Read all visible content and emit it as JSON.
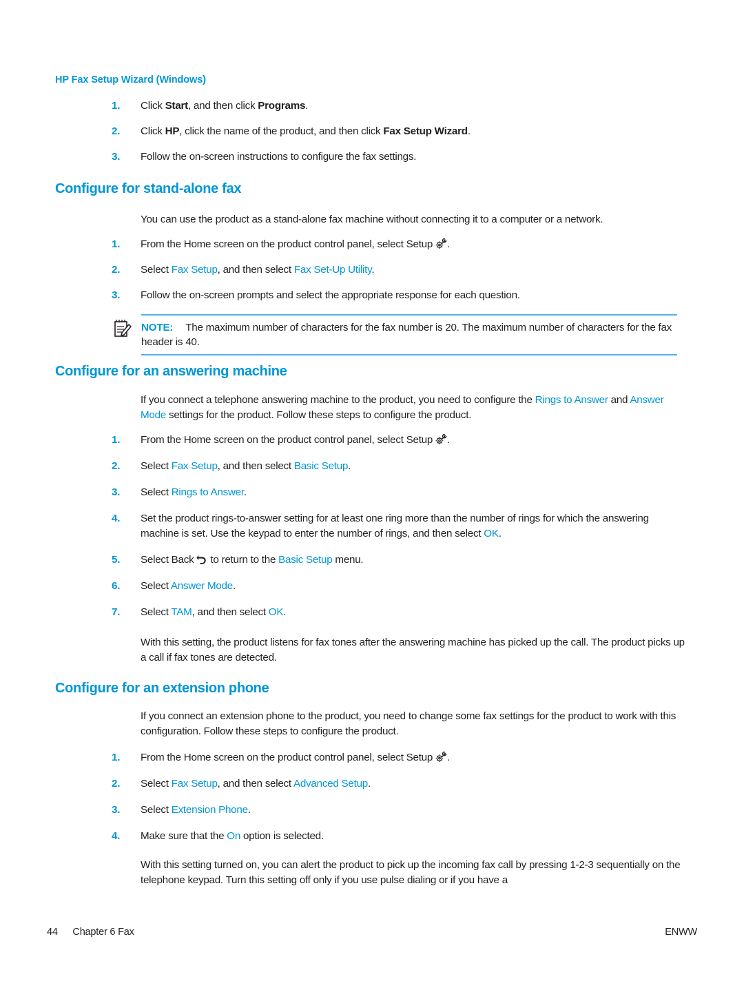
{
  "document": {
    "page_number": "44",
    "chapter": "Chapter 6  Fax",
    "locale_code": "ENWW",
    "accent_color": "#0096d6",
    "text_color": "#231f20"
  },
  "sections": {
    "wizard": {
      "heading": "HP Fax Setup Wizard (Windows)",
      "steps": [
        {
          "number": "1.",
          "parts": [
            {
              "t": "Click ",
              "style": "normal"
            },
            {
              "t": "Start",
              "style": "bold"
            },
            {
              "t": ", and then click ",
              "style": "normal"
            },
            {
              "t": "Programs",
              "style": "bold"
            },
            {
              "t": ".",
              "style": "normal"
            }
          ]
        },
        {
          "number": "2.",
          "parts": [
            {
              "t": "Click ",
              "style": "normal"
            },
            {
              "t": "HP",
              "style": "bold"
            },
            {
              "t": ", click the name of the product, and then click ",
              "style": "normal"
            },
            {
              "t": "Fax Setup Wizard",
              "style": "bold"
            },
            {
              "t": ".",
              "style": "normal"
            }
          ]
        },
        {
          "number": "3.",
          "parts": [
            {
              "t": "Follow the on-screen instructions to configure the fax settings.",
              "style": "normal"
            }
          ]
        }
      ]
    },
    "standalone": {
      "heading": "Configure for stand-alone fax",
      "intro": "You can use the product as a stand-alone fax machine without connecting it to a computer or a network.",
      "steps": [
        {
          "number": "1.",
          "parts": [
            {
              "t": "From the Home screen on the product control panel, select Setup ",
              "style": "normal"
            },
            {
              "t": "",
              "style": "icon",
              "icon": "setup-gear-wrench-icon"
            },
            {
              "t": ".",
              "style": "normal"
            }
          ]
        },
        {
          "number": "2.",
          "parts": [
            {
              "t": "Select ",
              "style": "normal"
            },
            {
              "t": "Fax Setup",
              "style": "link"
            },
            {
              "t": ", and then select ",
              "style": "normal"
            },
            {
              "t": "Fax Set-Up Utility",
              "style": "link"
            },
            {
              "t": ".",
              "style": "normal"
            }
          ]
        },
        {
          "number": "3.",
          "parts": [
            {
              "t": "Follow the on-screen prompts and select the appropriate response for each question.",
              "style": "normal"
            }
          ]
        }
      ],
      "note": {
        "label": "NOTE:",
        "text": "The maximum number of characters for the fax number is 20. The maximum number of characters for the fax header is 40.",
        "icon": "note-pad-pencil-icon"
      }
    },
    "answering_machine": {
      "heading": "Configure for an answering machine",
      "intro_parts": [
        {
          "t": "If you connect a telephone answering machine to the product, you need to configure the ",
          "style": "normal"
        },
        {
          "t": "Rings to Answer",
          "style": "link"
        },
        {
          "t": " and ",
          "style": "normal"
        },
        {
          "t": "Answer Mode",
          "style": "link"
        },
        {
          "t": " settings for the product. Follow these steps to configure the product.",
          "style": "normal"
        }
      ],
      "steps": [
        {
          "number": "1.",
          "parts": [
            {
              "t": "From the Home screen on the product control panel, select Setup ",
              "style": "normal"
            },
            {
              "t": "",
              "style": "icon",
              "icon": "setup-gear-wrench-icon"
            },
            {
              "t": ".",
              "style": "normal"
            }
          ]
        },
        {
          "number": "2.",
          "parts": [
            {
              "t": "Select ",
              "style": "normal"
            },
            {
              "t": "Fax Setup",
              "style": "link"
            },
            {
              "t": ", and then select ",
              "style": "normal"
            },
            {
              "t": "Basic Setup",
              "style": "link"
            },
            {
              "t": ".",
              "style": "normal"
            }
          ]
        },
        {
          "number": "3.",
          "parts": [
            {
              "t": "Select ",
              "style": "normal"
            },
            {
              "t": "Rings to Answer",
              "style": "link"
            },
            {
              "t": ".",
              "style": "normal"
            }
          ]
        },
        {
          "number": "4.",
          "parts": [
            {
              "t": "Set the product rings-to-answer setting for at least one ring more than the number of rings for which the answering machine is set. Use the keypad to enter the number of rings, and then select ",
              "style": "normal"
            },
            {
              "t": "OK",
              "style": "link"
            },
            {
              "t": ".",
              "style": "normal"
            }
          ]
        },
        {
          "number": "5.",
          "parts": [
            {
              "t": "Select Back ",
              "style": "normal"
            },
            {
              "t": "",
              "style": "icon",
              "icon": "back-arrow-icon"
            },
            {
              "t": " to return to the ",
              "style": "normal"
            },
            {
              "t": "Basic Setup",
              "style": "link"
            },
            {
              "t": " menu.",
              "style": "normal"
            }
          ]
        },
        {
          "number": "6.",
          "parts": [
            {
              "t": "Select ",
              "style": "normal"
            },
            {
              "t": "Answer Mode",
              "style": "link"
            },
            {
              "t": ".",
              "style": "normal"
            }
          ]
        },
        {
          "number": "7.",
          "parts": [
            {
              "t": "Select ",
              "style": "normal"
            },
            {
              "t": "TAM",
              "style": "link"
            },
            {
              "t": ", and then select ",
              "style": "normal"
            },
            {
              "t": "OK",
              "style": "link"
            },
            {
              "t": ".",
              "style": "normal"
            }
          ]
        }
      ],
      "outro": "With this setting, the product listens for fax tones after the answering machine has picked up the call. The product picks up a call if fax tones are detected."
    },
    "extension_phone": {
      "heading": "Configure for an extension phone",
      "intro": "If you connect an extension phone to the product, you need to change some fax settings for the product to work with this configuration. Follow these steps to configure the product.",
      "steps": [
        {
          "number": "1.",
          "parts": [
            {
              "t": "From the Home screen on the product control panel, select Setup ",
              "style": "normal"
            },
            {
              "t": "",
              "style": "icon",
              "icon": "setup-gear-wrench-icon"
            },
            {
              "t": ".",
              "style": "normal"
            }
          ]
        },
        {
          "number": "2.",
          "parts": [
            {
              "t": "Select ",
              "style": "normal"
            },
            {
              "t": "Fax Setup",
              "style": "link"
            },
            {
              "t": ", and then select ",
              "style": "normal"
            },
            {
              "t": "Advanced Setup",
              "style": "link"
            },
            {
              "t": ".",
              "style": "normal"
            }
          ]
        },
        {
          "number": "3.",
          "parts": [
            {
              "t": "Select ",
              "style": "normal"
            },
            {
              "t": "Extension Phone",
              "style": "link"
            },
            {
              "t": ".",
              "style": "normal"
            }
          ]
        },
        {
          "number": "4.",
          "parts": [
            {
              "t": "Make sure that the ",
              "style": "normal"
            },
            {
              "t": "On",
              "style": "link"
            },
            {
              "t": " option is selected.",
              "style": "normal"
            }
          ]
        }
      ],
      "outro": "With this setting turned on, you can alert the product to pick up the incoming fax call by pressing 1-2-3 sequentially on the telephone keypad. Turn this setting off only if you use pulse dialing or if you have a"
    }
  }
}
